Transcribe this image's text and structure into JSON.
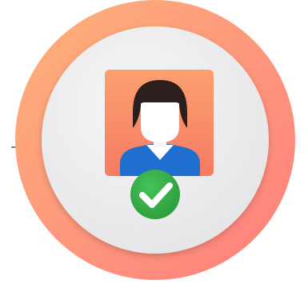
{
  "icon": {
    "name": "verified-user-icon",
    "parts": {
      "outer_ring": "gradient-ring",
      "inner_disc": "light-disc",
      "profile_card": "profile-card",
      "avatar": "person-avatar-icon",
      "badge": "check-badge-icon"
    }
  },
  "colors": {
    "ring_start": "#FDB27A",
    "ring_end": "#FF7E7E",
    "disc_light": "#F6F6F7",
    "disc_shade": "#E4E4E7",
    "card_top": "#FBA06F",
    "card_bottom": "#F67B63",
    "hair": "#2B1E1C",
    "face": "#FFFFFF",
    "shirt": "#1F6FD1",
    "collar": "#FFFFFF",
    "badge_green": "#38B84A",
    "badge_green_dark": "#2E9C3E",
    "check": "#FFFFFF"
  }
}
